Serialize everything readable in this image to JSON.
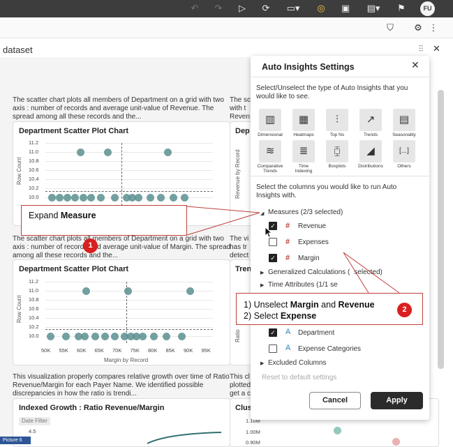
{
  "toolbar": {
    "icons": [
      "undo-icon",
      "redo-icon",
      "play-icon",
      "refresh-data-icon",
      "comment-icon",
      "insights-bulb-icon",
      "present-icon",
      "save-icon",
      "bookmark-icon"
    ],
    "avatar_initials": "FU"
  },
  "page": {
    "title": "dataset"
  },
  "canvas": {
    "desc1": "The scatter chart plots all members of Department on a grid with two axis : number of records and average unit-value of Revenue. The spread among all these records and the...",
    "card1": {
      "title": "Department Scatter Plot Chart",
      "ylabel": "Row Count",
      "yticks": [
        "11.2",
        "11.0",
        "10.8",
        "10.6",
        "10.4",
        "10.2",
        "10.0"
      ]
    },
    "desc2": "The scatter chart plots all members of Department on a grid with two axis : number of records and average unit-value of Margin. The spread among all these records and the...",
    "card2": {
      "title": "Department Scatter Plot Chart",
      "ylabel": "Row Count",
      "yticks": [
        "11.2",
        "11.0",
        "10.8",
        "10.6",
        "10.4",
        "10.2",
        "10.0"
      ],
      "xticks": [
        "50K",
        "55K",
        "60K",
        "65K",
        "70K",
        "75K",
        "80K",
        "85K",
        "90K",
        "95K"
      ],
      "xlabel": "Margin by Record"
    },
    "desc3": "This visualization properly compares relative growth over time of Ratio Revenue/Margin for each Payer Name. We identified possible discrepancies in how the ratio is trendi...",
    "card3": {
      "title": "Indexed Growth : Ratio Revenue/Margin",
      "filter_label": "Date Filter",
      "ytick": "4.5"
    },
    "right_partial": {
      "desc1": [
        "The sc",
        "with t",
        "Reven"
      ],
      "card1_title": "Dep",
      "card1_ylabel": "Revenue by Record",
      "desc2": [
        "The vi",
        "has tr",
        "detect"
      ],
      "card2_title": "Tren",
      "card2_ylabel": "Ratio",
      "desc3": [
        "This cl",
        "plotted",
        "get a c"
      ],
      "card3_title": "Clus",
      "card3_ticks": [
        "1.10M",
        "1.00M",
        "0.90M"
      ]
    }
  },
  "panel": {
    "title": "Auto Insights Settings",
    "intro": "Select/Unselect the type of Auto Insights that you would like to see.",
    "insight_types": [
      {
        "label": "Dimensional",
        "icon": "bar-chart-icon",
        "glyph": "▥"
      },
      {
        "label": "Heatmaps",
        "icon": "heatmap-icon",
        "glyph": "▦"
      },
      {
        "label": "Top Ns",
        "icon": "top-n-icon",
        "glyph": "⫶"
      },
      {
        "label": "Trends",
        "icon": "trend-chart-icon",
        "glyph": "↗"
      },
      {
        "label": "Seasonality",
        "icon": "calendar-icon",
        "glyph": "▤"
      },
      {
        "label": "Comparative Trends",
        "icon": "comparative-trend-icon",
        "glyph": "≋"
      },
      {
        "label": "Time Indexing",
        "icon": "time-index-icon",
        "glyph": "≣"
      },
      {
        "label": "Boxplots",
        "icon": "boxplot-icon",
        "glyph": "⧮"
      },
      {
        "label": "Distributions",
        "icon": "distribution-icon",
        "glyph": "◢"
      },
      {
        "label": "Others",
        "icon": "others-icon",
        "glyph": "[...]"
      }
    ],
    "columns_intro": "Select the columns you would like to run Auto Insights with.",
    "measures_header": "Measures (2/3 selected)",
    "measures": [
      {
        "label": "Revenue",
        "checked": true
      },
      {
        "label": "Expenses",
        "checked": false
      },
      {
        "label": "Margin",
        "checked": true
      }
    ],
    "generalized_header": "Generalized Calculations (",
    "generalized_suffix": "selected)",
    "time_header": "Time Attributes (1/1 se",
    "attributes": [
      {
        "label": "Department",
        "checked": true
      },
      {
        "label": "Expense Categories",
        "checked": false
      }
    ],
    "excluded_header": "Excluded Columns",
    "reset_label": "Reset to default settings",
    "cancel_label": "Cancel",
    "apply_label": "Apply"
  },
  "callouts": {
    "one": {
      "prefix": "Expand ",
      "bold": "Measure",
      "badge": "1"
    },
    "two": {
      "line1_prefix": "1) Unselect ",
      "line1_b1": "Margin",
      "line1_mid": " and ",
      "line1_b2": "Revenue",
      "line2_prefix": "2) Select ",
      "line2_bold": "Expense",
      "badge": "2"
    }
  },
  "picture_tag": "Picture 6",
  "colors": {
    "accent_red": "#d91f1f",
    "point": "#5b8f8f",
    "measure_hash": "#c0403a",
    "attr_blue": "#2c7fb8"
  }
}
